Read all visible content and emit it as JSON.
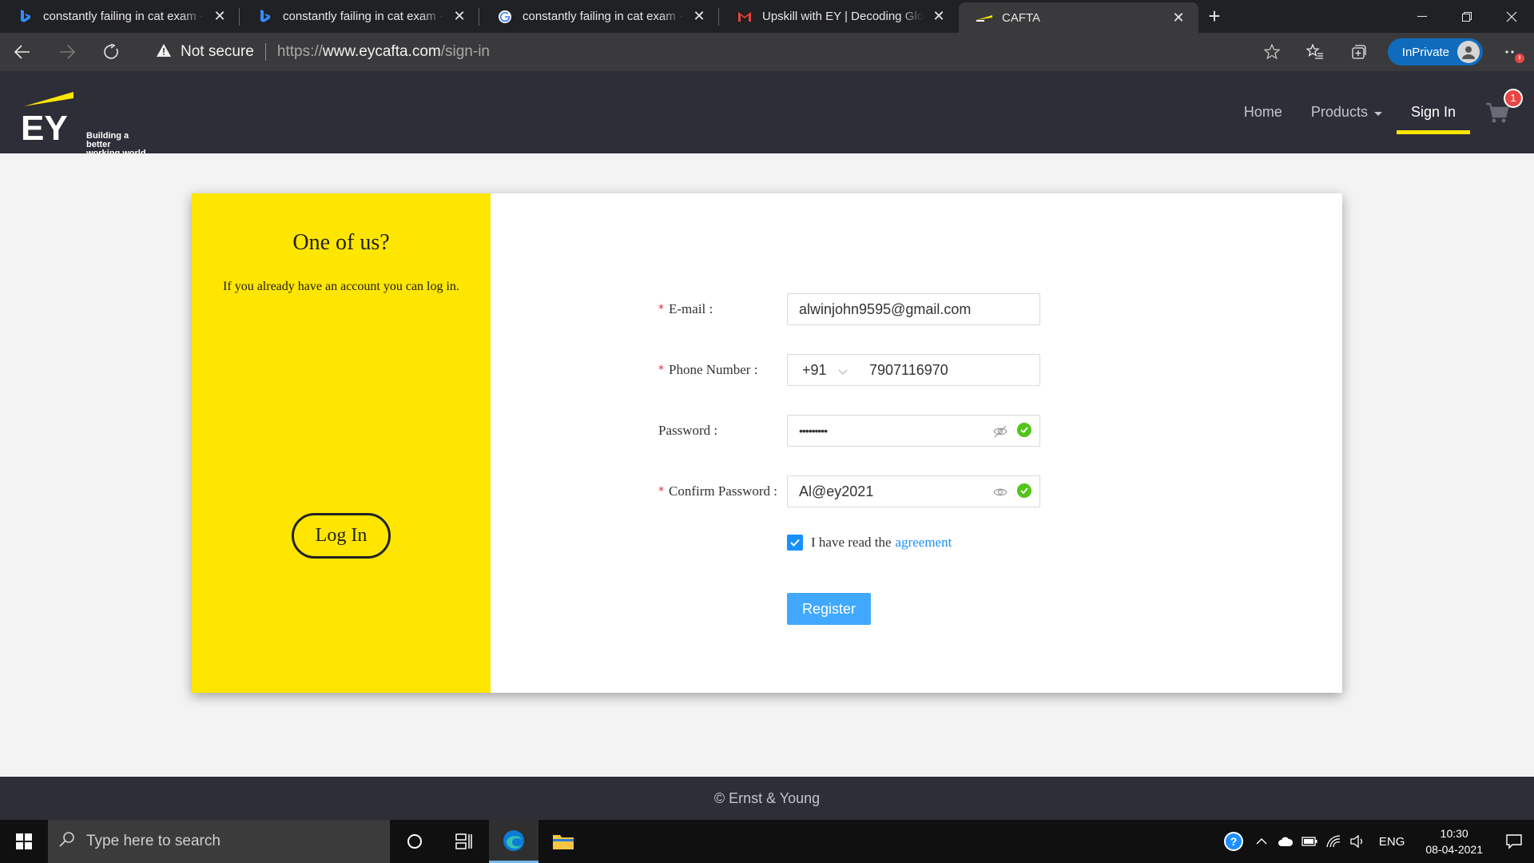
{
  "browser": {
    "tabs": [
      {
        "title": "constantly failing in cat exam - B",
        "icon": "bing-icon"
      },
      {
        "title": "constantly failing in cat exam - B",
        "icon": "bing-icon"
      },
      {
        "title": "constantly failing in cat exam - G",
        "icon": "google-icon"
      },
      {
        "title": "Upskill with EY | Decoding Globa",
        "icon": "gmail-icon"
      },
      {
        "title": "CAFTA",
        "icon": "ey-favicon",
        "active": true
      }
    ],
    "security_label": "Not secure",
    "url_prefix": "https://",
    "url_host": "www.eycafta.com",
    "url_path": "/sign-in",
    "inprivate_label": "InPrivate"
  },
  "site": {
    "tagline_line1": "Building a better",
    "tagline_line2": "working world",
    "nav": {
      "home": "Home",
      "products": "Products",
      "signin": "Sign In"
    },
    "cart_count": "1"
  },
  "left_panel": {
    "title": "One of us?",
    "subtitle": "If you already have an account you can log in.",
    "login_button": "Log In"
  },
  "form": {
    "email_label": "E-mail",
    "email_value": "alwinjohn9595@gmail.com",
    "phone_label": "Phone Number",
    "phone_prefix": "+91",
    "phone_value": "7907116970",
    "password_label": "Password",
    "password_value": "•••••••••",
    "confirm_label": "Confirm Password",
    "confirm_value": "Al@ey2021",
    "agree_text": "I have read the",
    "agree_link": "agreement",
    "agree_checked": true,
    "register_button": "Register"
  },
  "footer": {
    "copyright": "© Ernst & Young"
  },
  "taskbar": {
    "search_placeholder": "Type here to search",
    "language": "ENG",
    "time": "10:30",
    "date": "08-04-2021"
  },
  "colors": {
    "ey_yellow": "#ffe600",
    "header_dark": "#2e2e38",
    "link_blue": "#1890ff",
    "register_blue": "#40a9ff",
    "required_red": "#f5222d"
  }
}
